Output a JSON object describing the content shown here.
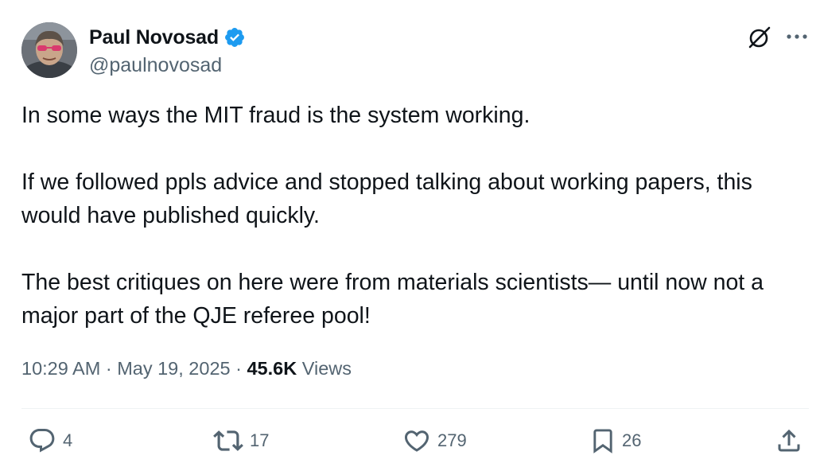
{
  "author": {
    "display_name": "Paul Novosad",
    "handle": "@paulnovosad",
    "verified": true
  },
  "tweet": {
    "paragraphs": [
      "In some ways the MIT fraud is the system working.",
      "If we followed ppls advice and stopped talking about working papers, this would have published quickly.",
      "The best critiques on here were from materials scientists— until now not a major part of the QJE referee pool!"
    ],
    "time": "10:29 AM",
    "separator": "·",
    "date": "May 19, 2025",
    "views_count": "45.6K",
    "views_label": "Views"
  },
  "actions": {
    "replies": "4",
    "reposts": "17",
    "likes": "279",
    "bookmarks": "26"
  },
  "icons": {
    "verified": "verified-badge-icon",
    "grok": "grok-icon",
    "more": "more-icon",
    "reply": "reply-icon",
    "repost": "repost-icon",
    "like": "heart-icon",
    "bookmark": "bookmark-icon",
    "share": "share-icon"
  },
  "colors": {
    "text": "#0f1419",
    "secondary": "#536471",
    "verified": "#1d9bf0",
    "divider": "#eff3f4"
  }
}
